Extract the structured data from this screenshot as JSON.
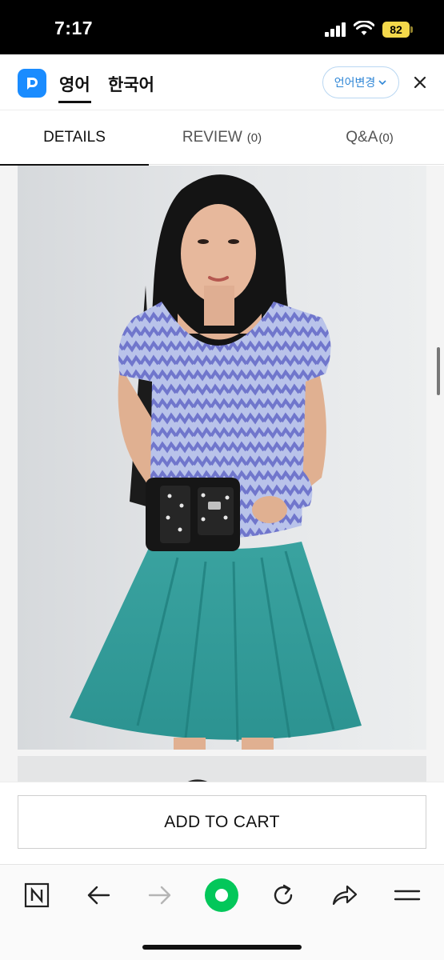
{
  "status_bar": {
    "time": "7:17",
    "battery_level": "82"
  },
  "translate_bar": {
    "tabs": [
      {
        "label": "영어",
        "active": true
      },
      {
        "label": "한국어",
        "active": false
      }
    ],
    "change_language_label": "언어변경",
    "accent_color": "#1a8cff"
  },
  "product_tabs": [
    {
      "label": "DETAILS",
      "count": "",
      "active": true
    },
    {
      "label": "REVIEW",
      "count": "(0)",
      "active": false
    },
    {
      "label": "Q&A",
      "count": "(0)",
      "active": false
    }
  ],
  "cart": {
    "add_to_cart_label": "ADD TO CART"
  },
  "toolbar": {
    "icons": [
      "naver-n-icon",
      "back-arrow-icon",
      "forward-arrow-icon",
      "green-home-icon",
      "reload-icon",
      "share-icon",
      "menu-icon"
    ],
    "brand_color": "#03c75a"
  }
}
